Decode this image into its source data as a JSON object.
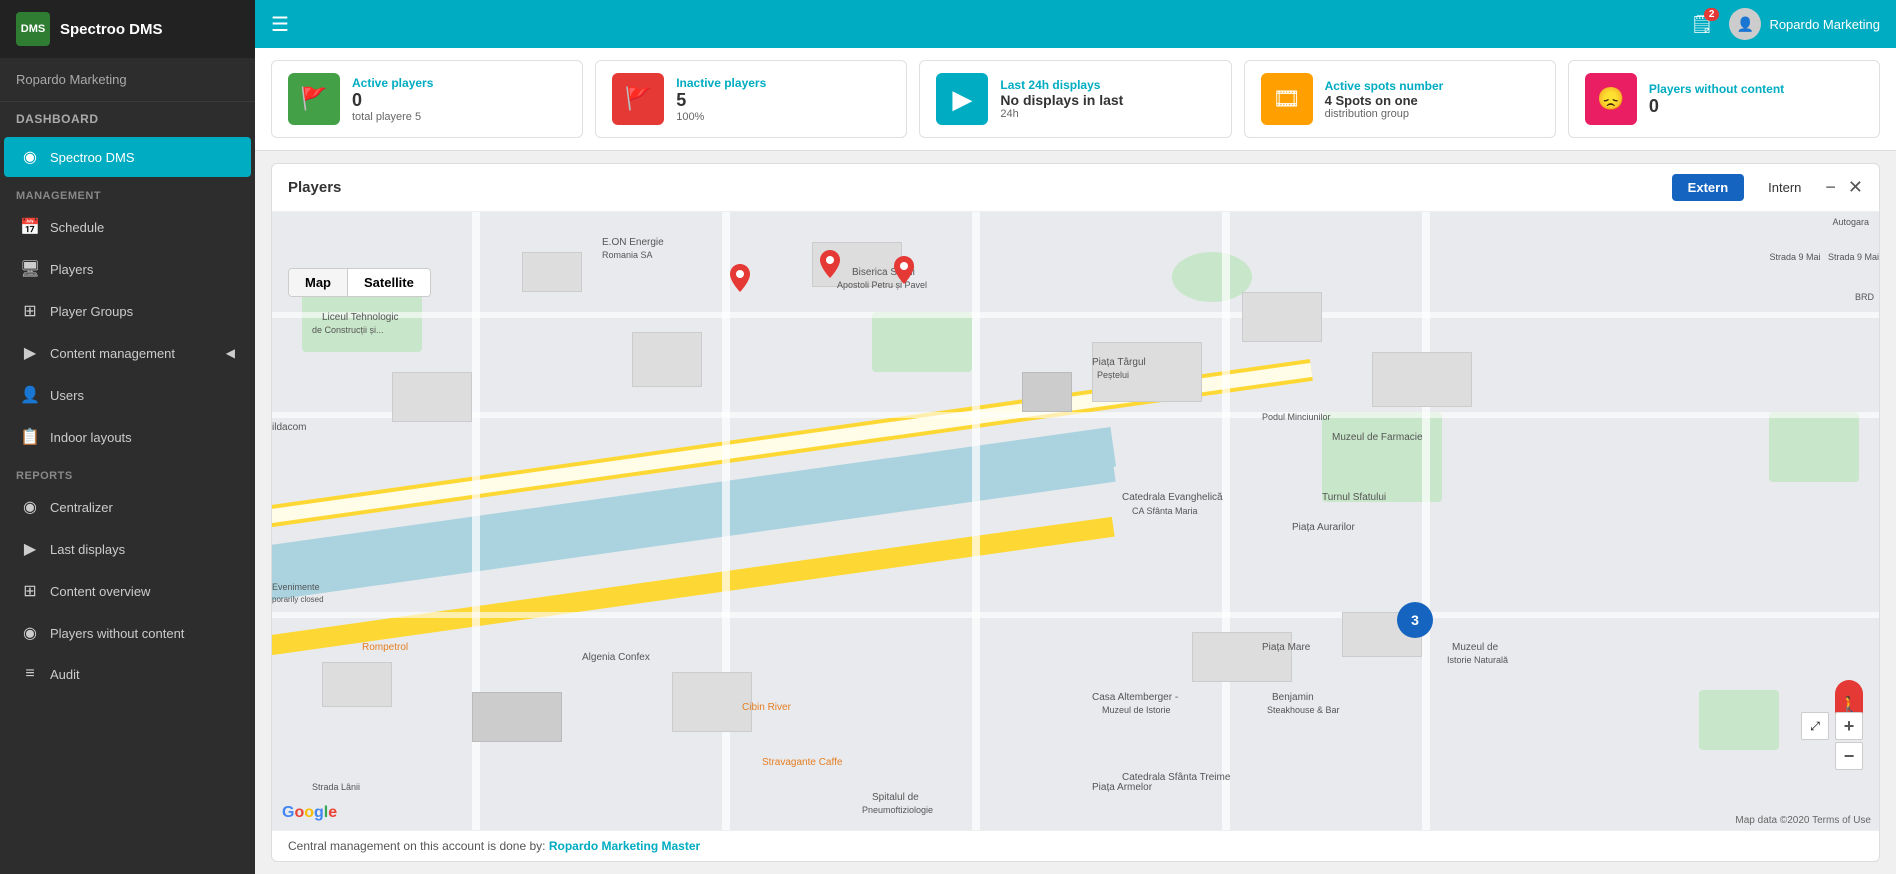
{
  "app": {
    "logo_text": "DMS",
    "title": "Spectroo DMS",
    "account": "Ropardo Marketing"
  },
  "topbar": {
    "menu_icon": "☰",
    "notifications_count": "2",
    "user_name": "Ropardo Marketing"
  },
  "sidebar": {
    "dashboard_label": "Dashboard",
    "active_item": "Spectroo DMS",
    "management_label": "Management",
    "reports_label": "Reports",
    "items_management": [
      {
        "label": "Schedule",
        "icon": "📅"
      },
      {
        "label": "Players",
        "icon": "🖥"
      },
      {
        "label": "Player Groups",
        "icon": "⊞"
      },
      {
        "label": "Content management",
        "icon": "▶",
        "has_arrow": true
      },
      {
        "label": "Users",
        "icon": "👤"
      },
      {
        "label": "Indoor layouts",
        "icon": "📋"
      }
    ],
    "items_reports": [
      {
        "label": "Centralizer",
        "icon": "◉"
      },
      {
        "label": "Last displays",
        "icon": "▶"
      },
      {
        "label": "Content overview",
        "icon": "⊞"
      },
      {
        "label": "Players without content",
        "icon": "◉"
      },
      {
        "label": "Audit",
        "icon": "≡"
      }
    ]
  },
  "stats": [
    {
      "icon": "🚩",
      "icon_class": "green",
      "label": "Active players",
      "value": "0",
      "sub": "total playere 5"
    },
    {
      "icon": "🚩",
      "icon_class": "red",
      "label": "Inactive players",
      "value": "5",
      "sub": "100%"
    },
    {
      "icon": "▶",
      "icon_class": "teal",
      "label": "Last 24h displays",
      "value": "No displays in last",
      "sub": "24h"
    },
    {
      "icon": "🎞",
      "icon_class": "amber",
      "label": "Active spots number",
      "value": "4 Spots on one",
      "sub": "distribution group"
    },
    {
      "icon": "😞",
      "icon_class": "pink",
      "label": "Players without content",
      "value": "0",
      "sub": ""
    }
  ],
  "map": {
    "title": "Players",
    "btn_extern": "Extern",
    "btn_intern": "Intern",
    "view_map": "Map",
    "view_satellite": "Satellite",
    "footer_text": "Central management on this account is done by:",
    "footer_link": "Ropardo Marketing Master",
    "attribution": "Map data ©2020  Terms of Use",
    "zoom_in": "+",
    "zoom_out": "−"
  }
}
